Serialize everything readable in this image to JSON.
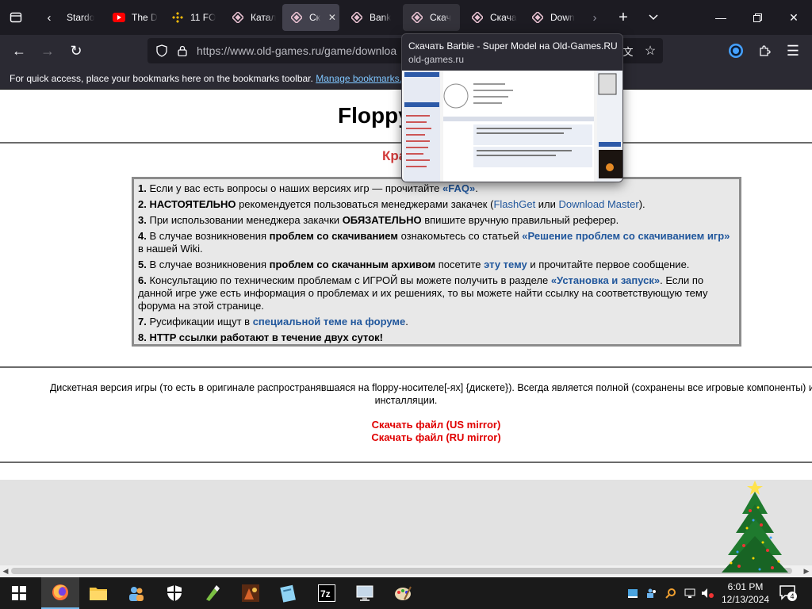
{
  "tabs": [
    {
      "label": "Stardo",
      "icon": "firefox-tab-icon"
    },
    {
      "label": "The D",
      "icon": "youtube-icon"
    },
    {
      "label": "11 FO",
      "icon": "binance-icon"
    },
    {
      "label": "Катал",
      "icon": "old-games-icon"
    },
    {
      "label": "Ск",
      "icon": "old-games-icon"
    },
    {
      "label": "Bank",
      "icon": "old-games-icon"
    },
    {
      "label": "Скач",
      "icon": "old-games-icon"
    },
    {
      "label": "Скача",
      "icon": "old-games-icon"
    },
    {
      "label": "Down",
      "icon": "old-games-icon"
    }
  ],
  "url": "https://www.old-games.ru/game/downloa",
  "bookmarks_bar": {
    "message": "For quick access, place your bookmarks here on the bookmarks toolbar.",
    "link": "Manage bookmarks..."
  },
  "tab_preview": {
    "title": "Скачать Barbie - Super Model на Old-Games.RU",
    "host": "old-games.ru"
  },
  "page": {
    "title": "Floppy",
    "red_heading": "Кра",
    "info": {
      "l1_num": "1.",
      "l1_a": "Если у вас есть вопросы о наших версиях игр — прочитайте ",
      "l1_link": "«FAQ»",
      "l1_b": ".",
      "l2_num": "2.",
      "l2_bold": "НАСТОЯТЕЛЬНО",
      "l2_a": " рекомендуется пользоваться менеджерами закачек (",
      "l2_link1": "FlashGet",
      "l2_b": " или ",
      "l2_link2": "Download Master",
      "l2_c": ").",
      "l3_num": "3.",
      "l3_a": "При использовании менеджера закачки ",
      "l3_bold": "ОБЯЗАТЕЛЬНО",
      "l3_b": " впишите вручную правильный реферер.",
      "l4_num": "4.",
      "l4_a": "В случае возникновения ",
      "l4_bold": "проблем со скачиванием",
      "l4_b": " ознакомьтесь со статьей ",
      "l4_link": "«Решение проблем со скачиванием игр»",
      "l4_c": " в нашей Wiki.",
      "l5_num": "5.",
      "l5_a": "В случае возникновения ",
      "l5_bold": "проблем со скачанным архивом",
      "l5_b": " посетите ",
      "l5_link": "эту тему",
      "l5_c": " и прочитайте первое сообщение.",
      "l6_num": "6.",
      "l6_a": "Консультацию по техническим проблемам с ИГРОЙ вы можете получить в разделе ",
      "l6_link": "«Установка и запуск»",
      "l6_b": ". Если по данной игре уже есть информация о проблемах и их решениях, то вы можете найти ссылку на соответствующую тему форума на этой странице.",
      "l7_num": "7.",
      "l7_a": "Русификации ищут в ",
      "l7_link": "специальной теме на форуме",
      "l7_b": ".",
      "l8_num": "8.",
      "l8_bold": "HTTP ссылки работают в течение двух суток!"
    },
    "description_line1": "Дискетная версия игры (то есть в оригинале распространявшаяся на floppy-носителе[-ях] {дискете}). Всегда является полной (сохранены все игровые компоненты) и н",
    "description_line2": "инсталляции.",
    "download_us": "Скачать файл (US mirror)",
    "download_ru": "Скачать файл (RU mirror)"
  },
  "taskbar": {
    "time": "6:01 PM",
    "date": "12/13/2024",
    "notifications": "4"
  },
  "colors": {
    "tabstrip": "#1c1b22",
    "toolbar": "#2b2a33",
    "link": "#21579c",
    "download_red": "#e00000"
  }
}
